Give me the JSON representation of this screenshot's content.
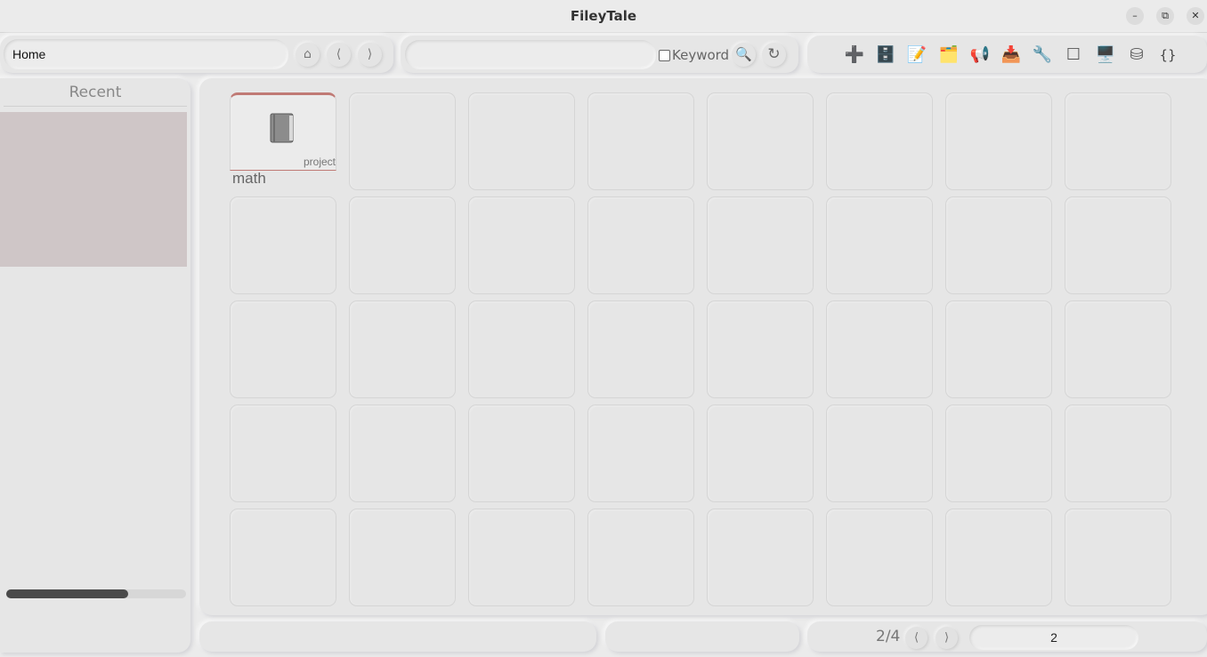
{
  "window": {
    "title": "FileyTale",
    "minimize": "–",
    "restore": "⧉",
    "close": "✕"
  },
  "toolbar": {
    "path": "Home",
    "home_icon": "⌂",
    "back_icon": "⟨",
    "forward_icon": "⟩",
    "search_placeholder": "",
    "keyword_label": "Keyword",
    "search_icon": "🔍",
    "refresh_icon": "↻",
    "tools": [
      {
        "name": "add-icon",
        "glyph": "➕"
      },
      {
        "name": "cabinet-icon",
        "glyph": "🗄️"
      },
      {
        "name": "memo-icon",
        "glyph": "📝"
      },
      {
        "name": "folders-icon",
        "glyph": "🗂️"
      },
      {
        "name": "megaphone-icon",
        "glyph": "📢"
      },
      {
        "name": "inbox-icon",
        "glyph": "📥"
      },
      {
        "name": "wrench-icon",
        "glyph": "🔧"
      },
      {
        "name": "square-icon",
        "glyph": "☐"
      },
      {
        "name": "monitor-icon",
        "glyph": "🖥️"
      },
      {
        "name": "database-icon",
        "glyph": "⛁"
      },
      {
        "name": "braces-icon",
        "glyph": "{}"
      }
    ]
  },
  "sidebar": {
    "heading": "Recent",
    "progress": 0.68
  },
  "grid": {
    "items": [
      {
        "name": "math",
        "tag": "project",
        "icon": "book-icon"
      }
    ]
  },
  "pager": {
    "label": "2/4",
    "prev_icon": "⟨",
    "next_icon": "⟩",
    "page_value": "2"
  }
}
